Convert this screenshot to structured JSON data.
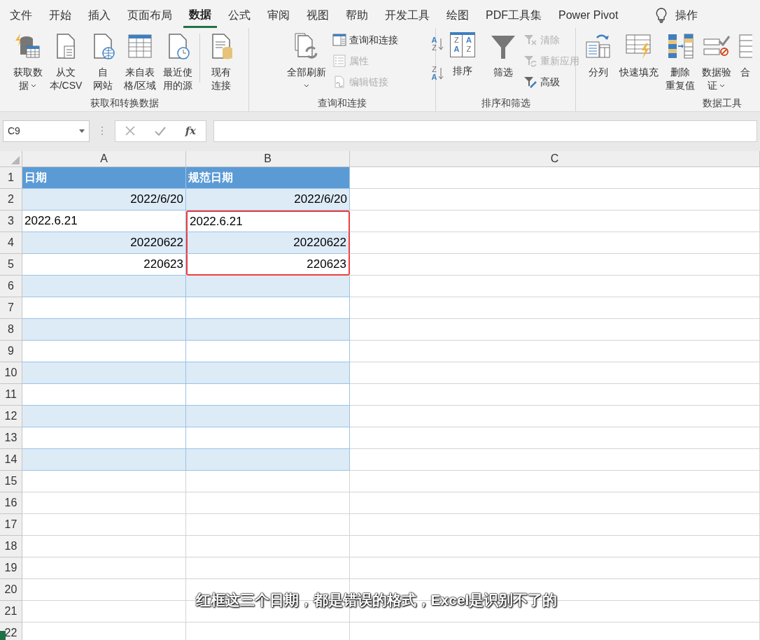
{
  "tabs": [
    {
      "label": "文件",
      "selected": false
    },
    {
      "label": "开始",
      "selected": false
    },
    {
      "label": "插入",
      "selected": false
    },
    {
      "label": "页面布局",
      "selected": false
    },
    {
      "label": "数据",
      "selected": true
    },
    {
      "label": "公式",
      "selected": false
    },
    {
      "label": "审阅",
      "selected": false
    },
    {
      "label": "视图",
      "selected": false
    },
    {
      "label": "帮助",
      "selected": false
    },
    {
      "label": "开发工具",
      "selected": false
    },
    {
      "label": "绘图",
      "selected": false
    },
    {
      "label": "PDF工具集",
      "selected": false
    },
    {
      "label": "Power Pivot",
      "selected": false
    }
  ],
  "tell_me": "操作",
  "ribbon_groups": [
    {
      "label": "获取和转换数据",
      "items": [
        {
          "kind": "large",
          "lines": [
            "获取数",
            "据"
          ],
          "dropdown": true
        },
        {
          "kind": "large",
          "lines": [
            "从文",
            "本/CSV"
          ],
          "dropdown": false
        },
        {
          "kind": "large",
          "lines": [
            "自",
            "网站"
          ],
          "dropdown": false
        },
        {
          "kind": "large",
          "lines": [
            "来自表",
            "格/区域"
          ],
          "dropdown": false
        },
        {
          "kind": "large",
          "lines": [
            "最近使",
            "用的源"
          ],
          "dropdown": false
        },
        {
          "kind": "separator"
        },
        {
          "kind": "large",
          "lines": [
            "现有",
            "连接"
          ],
          "dropdown": false
        }
      ]
    },
    {
      "label": "查询和连接",
      "items": [
        {
          "kind": "large",
          "lines": [
            "全部刷新"
          ],
          "dropdown": true
        },
        {
          "kind": "stack",
          "items": [
            {
              "label": "查询和连接",
              "disabled": false
            },
            {
              "label": "属性",
              "disabled": true
            },
            {
              "label": "编辑链接",
              "disabled": true
            }
          ]
        }
      ]
    },
    {
      "label": "排序和筛选",
      "items": [
        {
          "kind": "stack",
          "items": [
            {
              "letters": [
                "A",
                "Z"
              ]
            },
            {
              "letters": [
                "Z",
                "A"
              ]
            }
          ]
        },
        {
          "kind": "large",
          "lines": [
            "排序"
          ],
          "dropdown": false,
          "letters": [
            "Z",
            "A",
            "A",
            "Z"
          ]
        },
        {
          "kind": "separator"
        },
        {
          "kind": "large",
          "lines": [
            "筛选"
          ],
          "dropdown": false
        },
        {
          "kind": "stack",
          "items": [
            {
              "label": "清除",
              "disabled": true
            },
            {
              "label": "重新应用",
              "disabled": true
            },
            {
              "label": "高级",
              "disabled": false
            }
          ]
        }
      ]
    },
    {
      "label": "数据工具",
      "items": [
        {
          "kind": "large",
          "lines": [
            "分列"
          ],
          "dropdown": false
        },
        {
          "kind": "large",
          "lines": [
            "快速填充"
          ],
          "dropdown": false
        },
        {
          "kind": "large",
          "lines": [
            "删除",
            "重复值"
          ],
          "dropdown": false
        },
        {
          "kind": "large",
          "lines": [
            "数据验",
            "证"
          ],
          "dropdown": true
        },
        {
          "kind": "large",
          "lines": [
            "合"
          ],
          "dropdown": false
        }
      ]
    }
  ],
  "formula_bar": {
    "name_box": "C9",
    "fx": "fx"
  },
  "columns": [
    "A",
    "B",
    "C"
  ],
  "rows": [
    {
      "number": "1",
      "in_table": true,
      "header": true,
      "cells": [
        {
          "text": "日期",
          "kind": "text",
          "boxed": false
        },
        {
          "text": "规范日期",
          "kind": "text",
          "boxed": false
        }
      ]
    },
    {
      "number": "2",
      "in_table": true,
      "header": false,
      "cells": [
        {
          "text": "2022/6/20",
          "kind": "number",
          "boxed": false
        },
        {
          "text": "2022/6/20",
          "kind": "number",
          "boxed": false
        }
      ]
    },
    {
      "number": "3",
      "in_table": true,
      "header": false,
      "cells": [
        {
          "text": "2022.6.21",
          "kind": "text",
          "boxed": false
        },
        {
          "text": "2022.6.21",
          "kind": "text",
          "boxed": true
        }
      ]
    },
    {
      "number": "4",
      "in_table": true,
      "header": false,
      "cells": [
        {
          "text": "20220622",
          "kind": "number",
          "boxed": false
        },
        {
          "text": "20220622",
          "kind": "number",
          "boxed": true
        }
      ]
    },
    {
      "number": "5",
      "in_table": true,
      "header": false,
      "cells": [
        {
          "text": "220623",
          "kind": "number",
          "boxed": false
        },
        {
          "text": "220623",
          "kind": "number",
          "boxed": true
        }
      ]
    },
    {
      "number": "6",
      "in_table": true,
      "header": false,
      "cells": []
    },
    {
      "number": "7",
      "in_table": true,
      "header": false,
      "cells": []
    },
    {
      "number": "8",
      "in_table": true,
      "header": false,
      "cells": []
    },
    {
      "number": "9",
      "in_table": true,
      "header": false,
      "cells": []
    },
    {
      "number": "10",
      "in_table": true,
      "header": false,
      "cells": []
    },
    {
      "number": "11",
      "in_table": true,
      "header": false,
      "cells": []
    },
    {
      "number": "12",
      "in_table": true,
      "header": false,
      "cells": []
    },
    {
      "number": "13",
      "in_table": true,
      "header": false,
      "cells": []
    },
    {
      "number": "14",
      "in_table": true,
      "header": false,
      "cells": []
    },
    {
      "number": "15",
      "in_table": false,
      "header": false,
      "cells": []
    },
    {
      "number": "16",
      "in_table": false,
      "header": false,
      "cells": []
    },
    {
      "number": "17",
      "in_table": false,
      "header": false,
      "cells": []
    },
    {
      "number": "18",
      "in_table": false,
      "header": false,
      "cells": []
    },
    {
      "number": "19",
      "in_table": false,
      "header": false,
      "cells": []
    },
    {
      "number": "20",
      "in_table": false,
      "header": false,
      "cells": []
    },
    {
      "number": "21",
      "in_table": false,
      "header": false,
      "cells": []
    },
    {
      "number": "22",
      "in_table": false,
      "header": false,
      "cells": [],
      "marker": true
    }
  ],
  "subtitle": "红框这三个日期，都是错误的格式，Excel是识别不了的"
}
